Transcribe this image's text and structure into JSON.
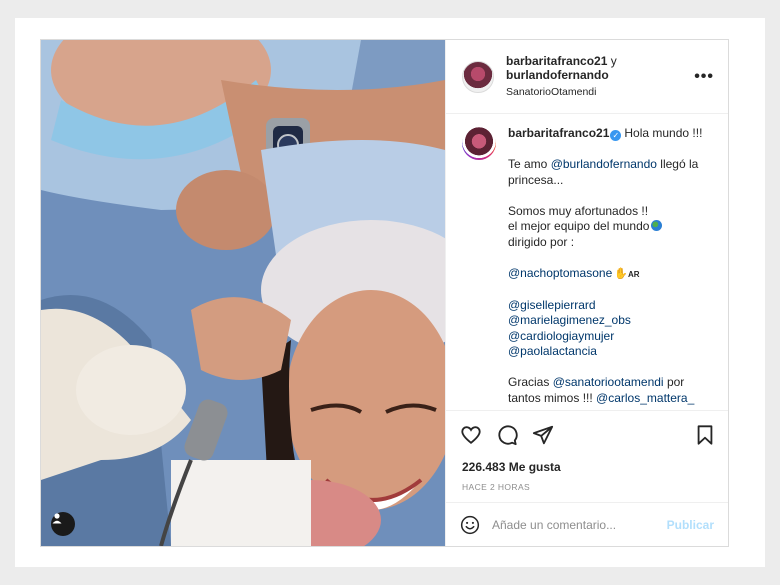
{
  "header": {
    "user1": "barbaritafranco21",
    "connector": "y",
    "user2": "burlandofernando",
    "location": "SanatorioOtamendi",
    "more_icon": "more-horizontal-icon"
  },
  "caption": {
    "username": "barbaritafranco21",
    "verified_icon": "verified-badge-icon",
    "first": "Hola mundo !!!",
    "l1a": "Te amo ",
    "l1m": "@burlandofernando",
    "l1b": " llegó la",
    "l2": "princesa...",
    "l3": "Somos muy afortunados !!",
    "l4": "el mejor equipo del mundo",
    "l5": "dirigido por :",
    "m1": "@nachoptomasone",
    "m1_flag": "AR",
    "m2": "@gisellepierrard",
    "m3": "@marielagimenez_obs",
    "m4": "@cardiologiaymujer",
    "m5": "@paolalactancia",
    "l6a": "Gracias ",
    "l6m": "@sanatoriootamendi",
    "l6b": " por",
    "l7a": "tantos mimos !!! ",
    "l7m": "@carlos_mattera_"
  },
  "actions": {
    "like_icon": "heart-icon",
    "comment_icon": "comment-icon",
    "share_icon": "send-icon",
    "save_icon": "bookmark-icon"
  },
  "likes": "226.483 Me gusta",
  "time": "HACE 2 HORAS",
  "comment_box": {
    "placeholder": "Añade un comentario...",
    "publish_label": "Publicar",
    "emoji_icon": "emoji-smile-icon"
  },
  "colors": {
    "link": "#00376b",
    "publish_disabled": "#b2dffc",
    "verified": "#3897f0",
    "muted": "#8e8e8e"
  }
}
